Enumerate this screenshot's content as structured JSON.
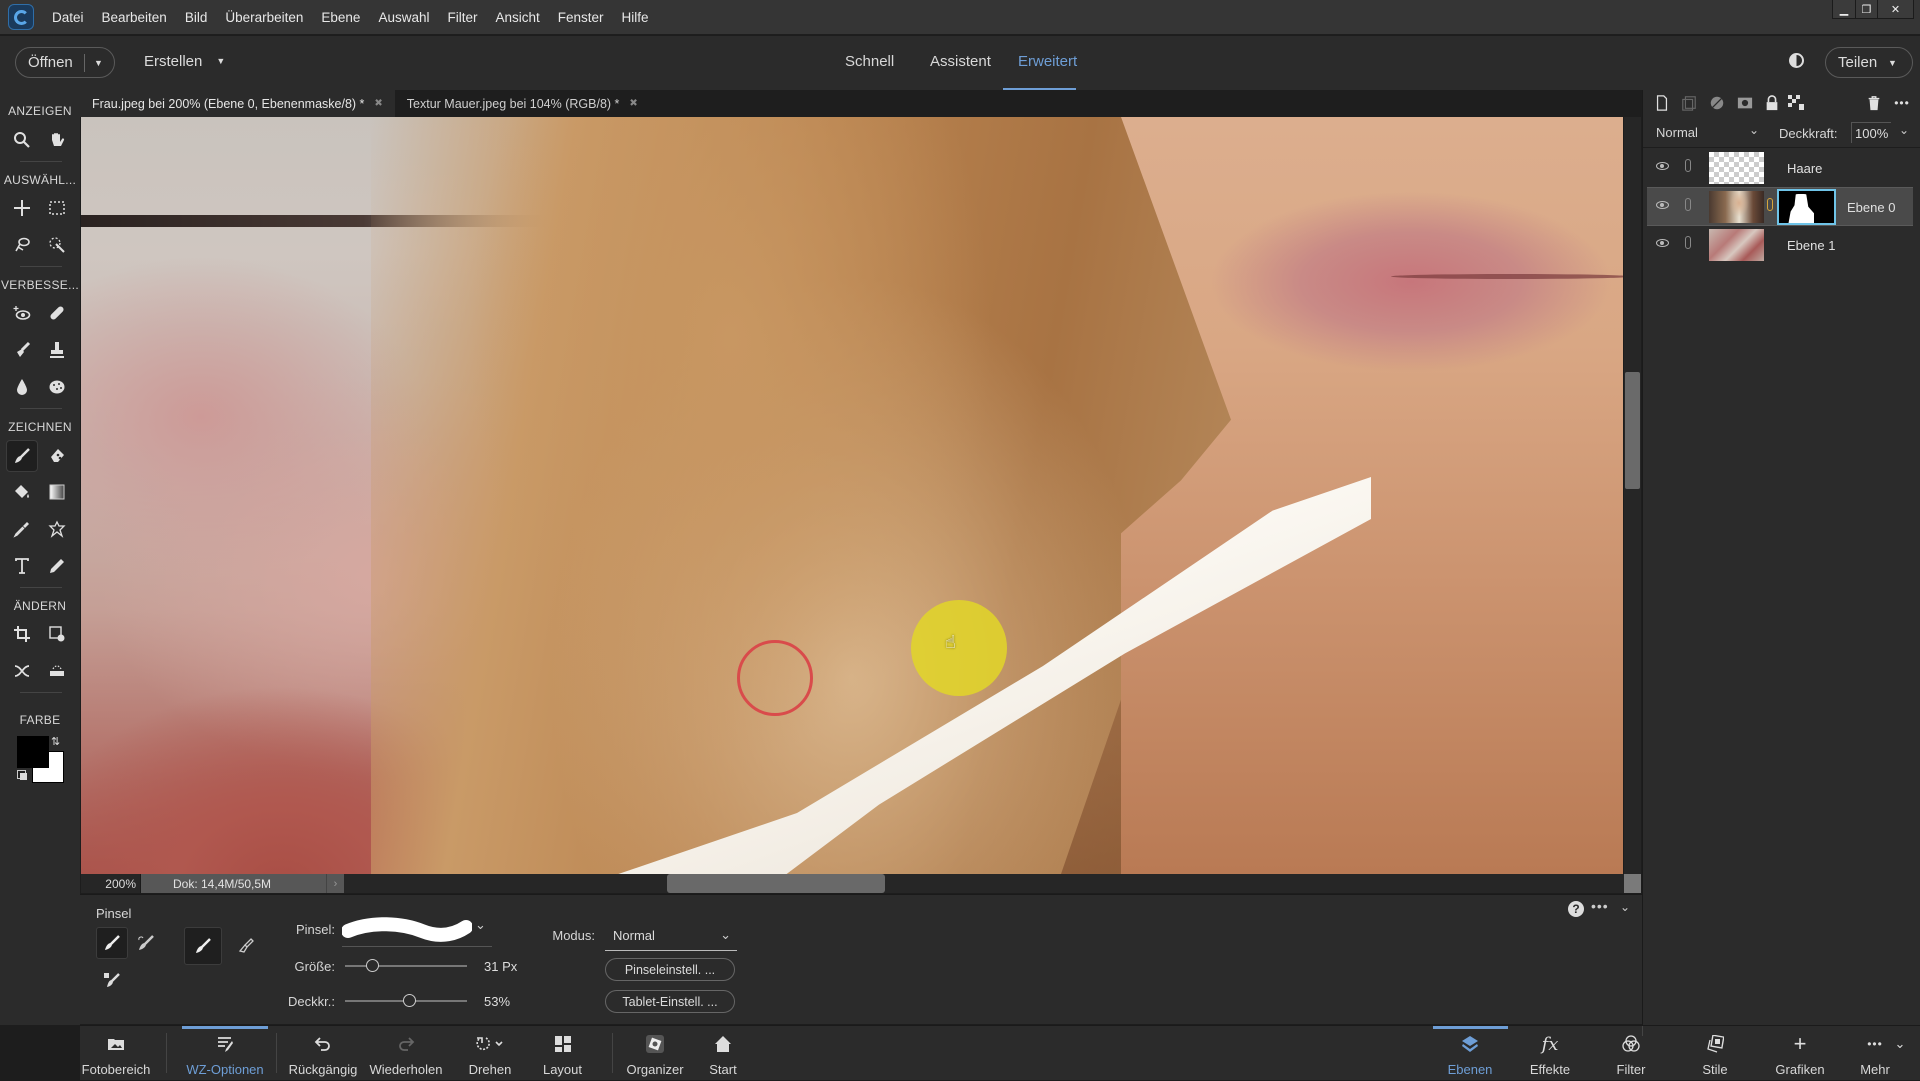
{
  "menubar": {
    "items": [
      "Datei",
      "Bearbeiten",
      "Bild",
      "Überarbeiten",
      "Ebene",
      "Auswahl",
      "Filter",
      "Ansicht",
      "Fenster",
      "Hilfe"
    ],
    "window_controls": {
      "minimize": "▁",
      "restore": "❐",
      "close": "✕"
    }
  },
  "modebar": {
    "open_label": "Öffnen",
    "create_label": "Erstellen",
    "tabs": [
      {
        "label": "Schnell",
        "active": false
      },
      {
        "label": "Assistent",
        "active": false
      },
      {
        "label": "Erweitert",
        "active": true
      }
    ],
    "share_label": "Teilen",
    "accent_color": "#6e9ed6"
  },
  "toolbox": {
    "sections": [
      {
        "label": "ANZEIGEN",
        "tools": [
          "zoom-tool",
          "hand-tool"
        ]
      },
      {
        "label": "AUSWÄHL...",
        "tools": [
          "move-tool",
          "marquee-tool",
          "lasso-tool",
          "quick-selection-tool"
        ]
      },
      {
        "label": "VERBESSE...",
        "tools": [
          "red-eye-tool",
          "spot-healing-tool",
          "smart-brush-tool",
          "clone-stamp-tool",
          "blur-tool",
          "sponge-tool"
        ]
      },
      {
        "label": "ZEICHNEN",
        "tools": [
          "brush-tool",
          "eraser-tool",
          "paint-bucket-tool",
          "gradient-tool",
          "eyedropper-tool",
          "custom-shape-tool",
          "type-tool",
          "pencil-tool"
        ]
      },
      {
        "label": "ÄNDERN",
        "tools": [
          "crop-tool",
          "recompose-tool",
          "content-aware-move-tool",
          "straighten-tool"
        ]
      },
      {
        "label": "FARBE",
        "tools": []
      }
    ],
    "active_tool": "brush-tool",
    "foreground_color": "#000000",
    "background_color": "#ffffff"
  },
  "document_tabs": [
    {
      "label": "Frau.jpeg bei 200% (Ebene 0, Ebenenmaske/8) *",
      "active": true
    },
    {
      "label": "Textur Mauer.jpeg bei 104% (RGB/8) *",
      "active": false
    }
  ],
  "status": {
    "zoom": "200%",
    "doc_size": "Dok: 14,4M/50,5M"
  },
  "tool_options": {
    "title": "Pinsel",
    "brush_label": "Pinsel:",
    "size_label": "Größe:",
    "size_value": "31 Px",
    "size_fraction": 0.19,
    "opacity_label": "Deckkr.:",
    "opacity_value": "53%",
    "opacity_fraction": 0.53,
    "mode_label": "Modus:",
    "mode_value": "Normal",
    "brush_settings_label": "Pinseleinstell. ...",
    "tablet_settings_label": "Tablet-Einstell. ..."
  },
  "layers_panel": {
    "blend_mode": "Normal",
    "opacity_label": "Deckkraft:",
    "opacity_value": "100%",
    "layers": [
      {
        "name": "Haare",
        "selected": false,
        "has_mask": false
      },
      {
        "name": "Ebene 0",
        "selected": true,
        "has_mask": true
      },
      {
        "name": "Ebene 1",
        "selected": false,
        "has_mask": false
      }
    ],
    "mask_border_color": "#6fc4e8"
  },
  "taskbar": {
    "left": [
      {
        "label": "Fotobereich",
        "icon": "photo-bin-icon",
        "active": false
      },
      {
        "label": "WZ-Optionen",
        "icon": "tool-options-icon",
        "active": true
      },
      {
        "label": "Rückgängig",
        "icon": "undo-icon",
        "active": false
      },
      {
        "label": "Wiederholen",
        "icon": "redo-icon",
        "active": false
      },
      {
        "label": "Drehen",
        "icon": "rotate-icon",
        "active": false
      },
      {
        "label": "Layout",
        "icon": "layout-icon",
        "active": false
      },
      {
        "label": "Organizer",
        "icon": "organizer-icon",
        "active": false
      },
      {
        "label": "Start",
        "icon": "home-icon",
        "active": false
      }
    ],
    "right": [
      {
        "label": "Ebenen",
        "icon": "layers-icon",
        "active": true
      },
      {
        "label": "Effekte",
        "icon": "fx-icon",
        "active": false
      },
      {
        "label": "Filter",
        "icon": "filter-icon",
        "active": false
      },
      {
        "label": "Stile",
        "icon": "styles-icon",
        "active": false
      },
      {
        "label": "Grafiken",
        "icon": "plus-icon",
        "active": false
      },
      {
        "label": "Mehr",
        "icon": "more-icon",
        "active": false
      }
    ]
  }
}
